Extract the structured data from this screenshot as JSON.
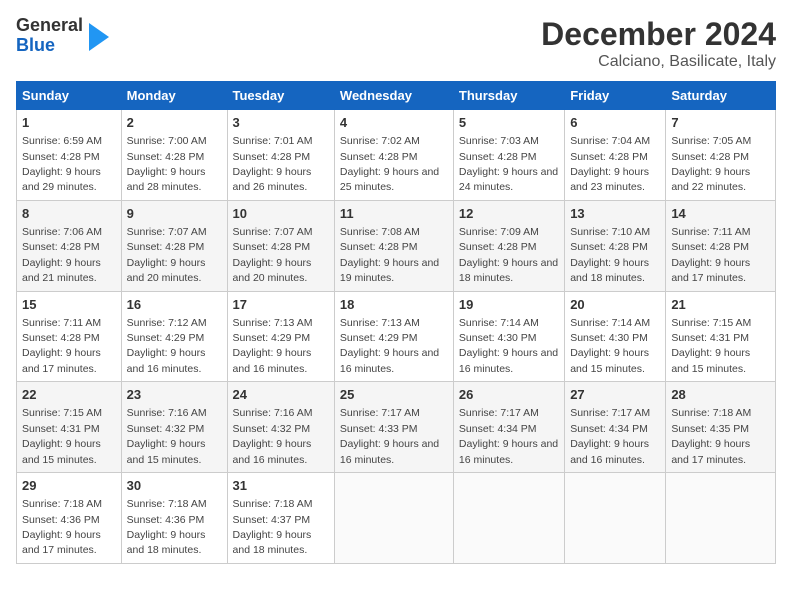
{
  "logo": {
    "line1": "General",
    "line2": "Blue"
  },
  "title": "December 2024",
  "subtitle": "Calciano, Basilicate, Italy",
  "weekdays": [
    "Sunday",
    "Monday",
    "Tuesday",
    "Wednesday",
    "Thursday",
    "Friday",
    "Saturday"
  ],
  "weeks": [
    [
      {
        "day": "1",
        "sunrise": "6:59 AM",
        "sunset": "4:28 PM",
        "daylight": "9 hours and 29 minutes."
      },
      {
        "day": "2",
        "sunrise": "7:00 AM",
        "sunset": "4:28 PM",
        "daylight": "9 hours and 28 minutes."
      },
      {
        "day": "3",
        "sunrise": "7:01 AM",
        "sunset": "4:28 PM",
        "daylight": "9 hours and 26 minutes."
      },
      {
        "day": "4",
        "sunrise": "7:02 AM",
        "sunset": "4:28 PM",
        "daylight": "9 hours and 25 minutes."
      },
      {
        "day": "5",
        "sunrise": "7:03 AM",
        "sunset": "4:28 PM",
        "daylight": "9 hours and 24 minutes."
      },
      {
        "day": "6",
        "sunrise": "7:04 AM",
        "sunset": "4:28 PM",
        "daylight": "9 hours and 23 minutes."
      },
      {
        "day": "7",
        "sunrise": "7:05 AM",
        "sunset": "4:28 PM",
        "daylight": "9 hours and 22 minutes."
      }
    ],
    [
      {
        "day": "8",
        "sunrise": "7:06 AM",
        "sunset": "4:28 PM",
        "daylight": "9 hours and 21 minutes."
      },
      {
        "day": "9",
        "sunrise": "7:07 AM",
        "sunset": "4:28 PM",
        "daylight": "9 hours and 20 minutes."
      },
      {
        "day": "10",
        "sunrise": "7:07 AM",
        "sunset": "4:28 PM",
        "daylight": "9 hours and 20 minutes."
      },
      {
        "day": "11",
        "sunrise": "7:08 AM",
        "sunset": "4:28 PM",
        "daylight": "9 hours and 19 minutes."
      },
      {
        "day": "12",
        "sunrise": "7:09 AM",
        "sunset": "4:28 PM",
        "daylight": "9 hours and 18 minutes."
      },
      {
        "day": "13",
        "sunrise": "7:10 AM",
        "sunset": "4:28 PM",
        "daylight": "9 hours and 18 minutes."
      },
      {
        "day": "14",
        "sunrise": "7:11 AM",
        "sunset": "4:28 PM",
        "daylight": "9 hours and 17 minutes."
      }
    ],
    [
      {
        "day": "15",
        "sunrise": "7:11 AM",
        "sunset": "4:28 PM",
        "daylight": "9 hours and 17 minutes."
      },
      {
        "day": "16",
        "sunrise": "7:12 AM",
        "sunset": "4:29 PM",
        "daylight": "9 hours and 16 minutes."
      },
      {
        "day": "17",
        "sunrise": "7:13 AM",
        "sunset": "4:29 PM",
        "daylight": "9 hours and 16 minutes."
      },
      {
        "day": "18",
        "sunrise": "7:13 AM",
        "sunset": "4:29 PM",
        "daylight": "9 hours and 16 minutes."
      },
      {
        "day": "19",
        "sunrise": "7:14 AM",
        "sunset": "4:30 PM",
        "daylight": "9 hours and 16 minutes."
      },
      {
        "day": "20",
        "sunrise": "7:14 AM",
        "sunset": "4:30 PM",
        "daylight": "9 hours and 15 minutes."
      },
      {
        "day": "21",
        "sunrise": "7:15 AM",
        "sunset": "4:31 PM",
        "daylight": "9 hours and 15 minutes."
      }
    ],
    [
      {
        "day": "22",
        "sunrise": "7:15 AM",
        "sunset": "4:31 PM",
        "daylight": "9 hours and 15 minutes."
      },
      {
        "day": "23",
        "sunrise": "7:16 AM",
        "sunset": "4:32 PM",
        "daylight": "9 hours and 15 minutes."
      },
      {
        "day": "24",
        "sunrise": "7:16 AM",
        "sunset": "4:32 PM",
        "daylight": "9 hours and 16 minutes."
      },
      {
        "day": "25",
        "sunrise": "7:17 AM",
        "sunset": "4:33 PM",
        "daylight": "9 hours and 16 minutes."
      },
      {
        "day": "26",
        "sunrise": "7:17 AM",
        "sunset": "4:34 PM",
        "daylight": "9 hours and 16 minutes."
      },
      {
        "day": "27",
        "sunrise": "7:17 AM",
        "sunset": "4:34 PM",
        "daylight": "9 hours and 16 minutes."
      },
      {
        "day": "28",
        "sunrise": "7:18 AM",
        "sunset": "4:35 PM",
        "daylight": "9 hours and 17 minutes."
      }
    ],
    [
      {
        "day": "29",
        "sunrise": "7:18 AM",
        "sunset": "4:36 PM",
        "daylight": "9 hours and 17 minutes."
      },
      {
        "day": "30",
        "sunrise": "7:18 AM",
        "sunset": "4:36 PM",
        "daylight": "9 hours and 18 minutes."
      },
      {
        "day": "31",
        "sunrise": "7:18 AM",
        "sunset": "4:37 PM",
        "daylight": "9 hours and 18 minutes."
      },
      null,
      null,
      null,
      null
    ]
  ]
}
